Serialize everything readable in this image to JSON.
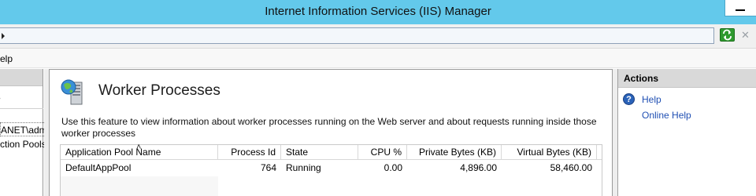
{
  "window": {
    "title": "Internet Information Services (IIS) Manager"
  },
  "menu": {
    "help_label": "elp"
  },
  "connections": {
    "items": [
      {
        "label": "ANET\\adm"
      },
      {
        "label": "ction Pools"
      }
    ]
  },
  "feature": {
    "title": "Worker Processes",
    "description": "Use this feature to view information about worker processes running on the Web server and about requests running inside those worker processes"
  },
  "grid": {
    "columns": [
      {
        "label": "Application Pool Name"
      },
      {
        "label": "Process Id"
      },
      {
        "label": "State"
      },
      {
        "label": "CPU %"
      },
      {
        "label": "Private Bytes (KB)"
      },
      {
        "label": "Virtual Bytes (KB)"
      }
    ],
    "rows": [
      {
        "app_pool": "DefaultAppPool",
        "process_id": "764",
        "state": "Running",
        "cpu": "0.00",
        "private_bytes": "4,896.00",
        "virtual_bytes": "58,460.00"
      }
    ]
  },
  "actions": {
    "title": "Actions",
    "items": [
      {
        "label": "Help",
        "icon": "help-icon"
      },
      {
        "label": "Online Help"
      }
    ]
  }
}
